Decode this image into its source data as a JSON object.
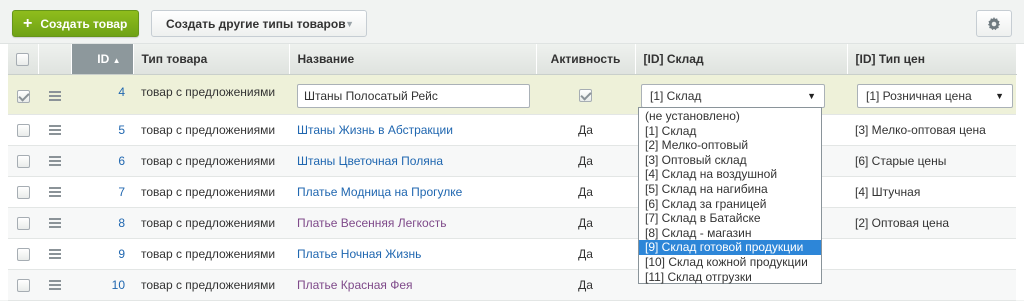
{
  "toolbar": {
    "create_label": "Создать товар",
    "other_label": "Создать другие типы товаров"
  },
  "columns": {
    "id": "ID",
    "type": "Тип товара",
    "name": "Название",
    "active": "Активность",
    "store": "[ID] Склад",
    "price_type": "[ID] Тип цен"
  },
  "edit_row": {
    "id": "4",
    "type": "товар с предложениями",
    "name_value": "Штаны Полосатый Рейс",
    "store_selected": "[1] Склад",
    "price_selected": "[1] Розничная цена"
  },
  "rows": [
    {
      "id": "5",
      "type": "товар с предложениями",
      "name": "Штаны Жизнь в Абстракции",
      "active": "Да",
      "price": "[3] Мелко-оптовая цена"
    },
    {
      "id": "6",
      "type": "товар с предложениями",
      "name": "Штаны Цветочная Поляна",
      "active": "Да",
      "price": "[6] Старые цены"
    },
    {
      "id": "7",
      "type": "товар с предложениями",
      "name": "Платье Модница на Прогулке",
      "active": "Да",
      "price": "[4] Штучная"
    },
    {
      "id": "8",
      "type": "товар с предложениями",
      "name": "Платье Весенняя Легкость",
      "active": "Да",
      "price": "[2] Оптовая цена"
    },
    {
      "id": "9",
      "type": "товар с предложениями",
      "name": "Платье Ночная Жизнь",
      "active": "Да",
      "price": ""
    },
    {
      "id": "10",
      "type": "товар с предложениями",
      "name": "Платье Красная Фея",
      "active": "Да",
      "price": ""
    }
  ],
  "store_options": [
    "(не установлено)",
    "[1] Склад",
    "[2] Мелко-оптовый",
    "[3] Оптовый склад",
    "[4] Склад на воздушной",
    "[5] Склад на нагибина",
    "[6] Склад за границей",
    "[7] Склад в Батайске",
    "[8] Склад - магазин",
    "[9] Склад готовой продукции",
    "[10] Склад кожной продукции",
    "[11] Склад отгрузки"
  ],
  "store_highlighted": "[9] Склад готовой продукции",
  "colors": {
    "accent_green": "#7bb01a",
    "link_blue": "#2067b0",
    "visited_purple": "#7f4a8a",
    "highlight": "#2d86d8"
  }
}
